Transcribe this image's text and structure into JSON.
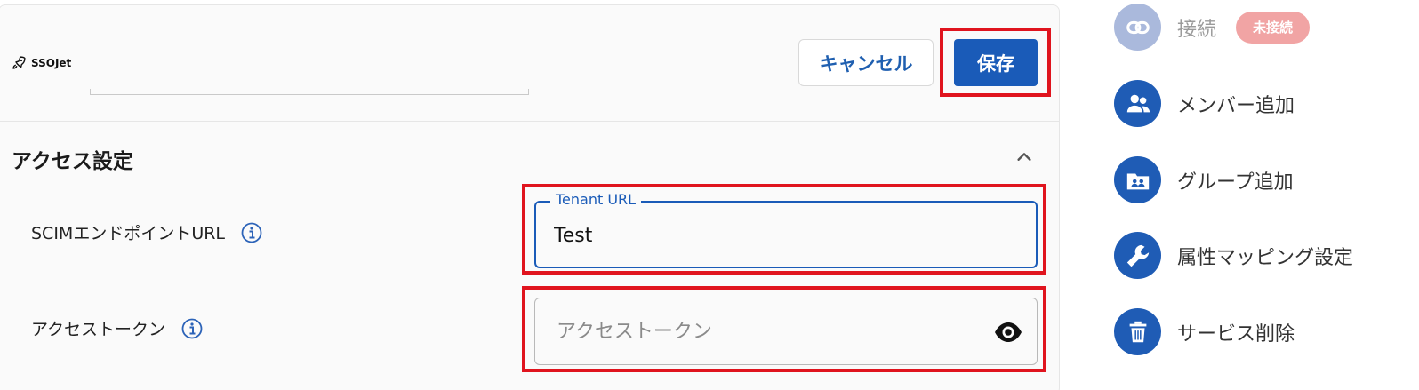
{
  "header": {
    "logo_text": "SSOJet",
    "cancel_label": "キャンセル",
    "save_label": "保存"
  },
  "access_settings": {
    "title": "アクセス設定",
    "scim_url": {
      "label": "SCIMエンドポイントURL",
      "floating_label": "Tenant URL",
      "value": "Test"
    },
    "access_token": {
      "label": "アクセストークン",
      "placeholder": "アクセストークン",
      "value": ""
    }
  },
  "side_menu": {
    "items": [
      {
        "label": "接続",
        "icon": "link-icon",
        "disabled": true,
        "badge": "未接続"
      },
      {
        "label": "メンバー追加",
        "icon": "users-icon"
      },
      {
        "label": "グループ追加",
        "icon": "group-folder-icon"
      },
      {
        "label": "属性マッピング設定",
        "icon": "wrench-icon"
      },
      {
        "label": "サービス削除",
        "icon": "trash-icon"
      }
    ]
  },
  "colors": {
    "primary": "#1a5bb8",
    "highlight": "#e0141e",
    "badge": "#f1a4a4",
    "disabled_icon": "#aab9dc"
  }
}
